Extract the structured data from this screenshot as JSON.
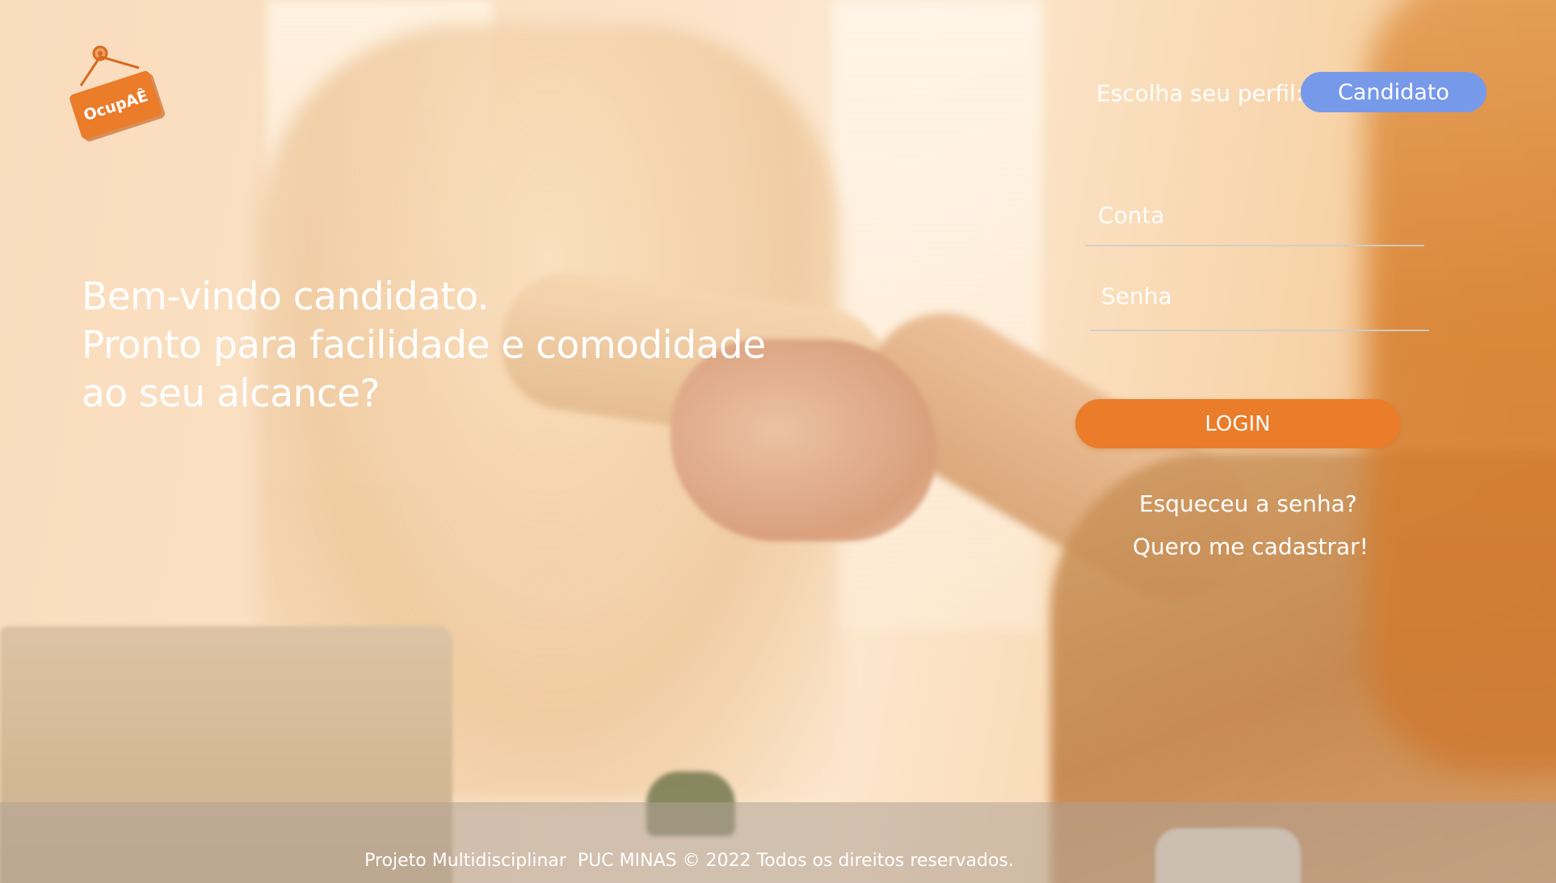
{
  "brand": {
    "logo_text": "OcupAÊ"
  },
  "header": {
    "profile_label": "Escolha seu perfil:",
    "profile_selected": "Candidato"
  },
  "hero": {
    "line1": "Bem-vindo candidato.",
    "line2": "Pronto para facilidade e comodidade",
    "line3": "ao seu alcance?"
  },
  "login_form": {
    "account_placeholder": "Conta",
    "password_placeholder": "Senha",
    "account_value": "",
    "password_value": "",
    "login_label": "LOGIN",
    "forgot_label": "Esqueceu a senha?",
    "register_label": "Quero me cadastrar!"
  },
  "footer": {
    "project": "Projeto Multidisciplinar",
    "institution": "PUC MINAS © 2022 Todos os direitos reservados."
  },
  "colors": {
    "accent": "#ea7c2a",
    "profile_button": "#7799ea",
    "text": "#ffffff"
  }
}
